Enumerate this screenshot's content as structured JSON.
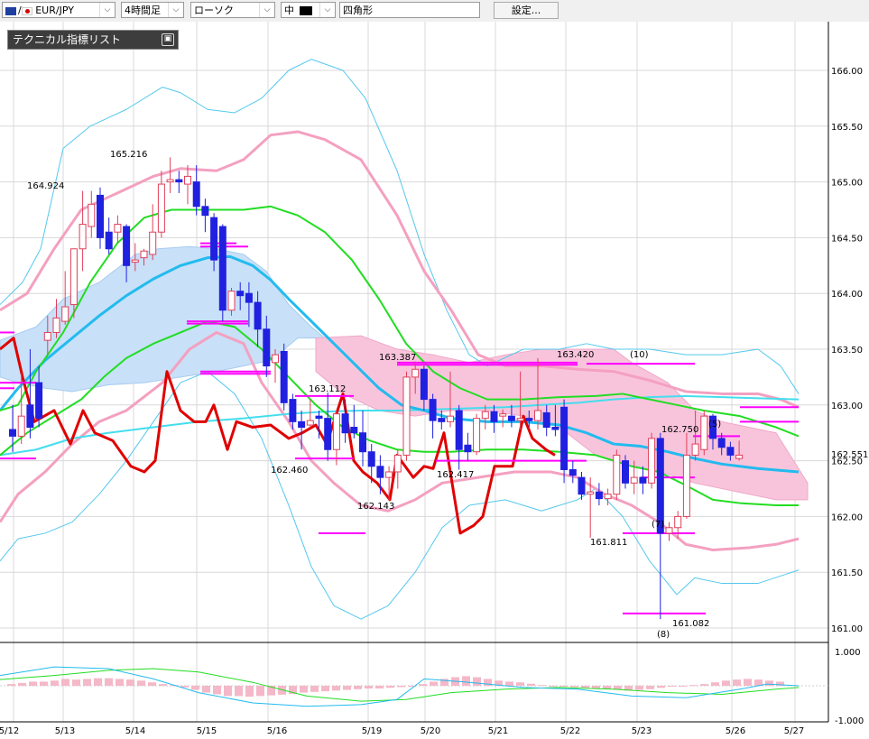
{
  "toolbar": {
    "pair": "EUR/JPY",
    "timeframe": "4時間足",
    "chart_style": "ローソク",
    "size": "中",
    "shape": "四角形",
    "settings_label": "設定..."
  },
  "panel": {
    "title": "テクニカル指標リスト",
    "button_icon": "minimize-icon"
  },
  "colors": {
    "bull_candle": "#e0405a",
    "bear_candle": "#2020e0",
    "bollinger_outer": "#55c8ee",
    "bollinger_inner": "#f4a0c0",
    "ma_green": "#22dd22",
    "ma_blue": "#22bbee",
    "ma_cyan": "#44ddee",
    "red_line": "#e00000",
    "cloud_blue": "#c8e0f8",
    "cloud_pink": "#f8c4dc",
    "pivot": "#ff00ff",
    "label_purple": "#a020a0"
  },
  "chart_data": {
    "type": "candlestick",
    "price_axis": {
      "ylim": [
        160.78,
        166.2
      ],
      "ticks": [
        "166.00",
        "165.50",
        "165.00",
        "164.50",
        "164.00",
        "163.50",
        "163.00",
        "162.50",
        "162.00",
        "161.50",
        "161.00"
      ],
      "current_price": "162.551"
    },
    "sub_axis": {
      "ylim": [
        -1.0,
        1.0
      ],
      "ticks": [
        "1.000",
        "-1.000"
      ]
    },
    "x_labels": [
      "5/12",
      "5/13",
      "5/14",
      "5/15",
      "5/16",
      "5/19",
      "5/20",
      "5/21",
      "5/22",
      "5/23",
      "5/26",
      "5/27"
    ],
    "price_labels": [
      "164.924",
      "165.216",
      "163.112",
      "162.460",
      "162.143",
      "163.387",
      "162.417",
      "163.420",
      "161.811",
      "162.750",
      "161.082"
    ],
    "count_labels": [
      "(10)",
      "(5)",
      "(7)",
      "(8)"
    ],
    "candles": [
      {
        "o": 162.78,
        "h": 163.0,
        "c": 162.72,
        "l": 162.58
      },
      {
        "o": 162.72,
        "h": 163.28,
        "c": 162.9,
        "l": 162.65
      },
      {
        "o": 163.0,
        "h": 163.5,
        "c": 162.8,
        "l": 162.7
      },
      {
        "o": 163.2,
        "h": 163.35,
        "c": 162.88,
        "l": 162.8
      },
      {
        "o": 163.58,
        "h": 163.8,
        "c": 163.65,
        "l": 163.45
      },
      {
        "o": 163.65,
        "h": 163.95,
        "c": 163.78,
        "l": 163.6
      },
      {
        "o": 163.75,
        "h": 164.2,
        "c": 163.88,
        "l": 163.72
      },
      {
        "o": 163.9,
        "h": 164.25,
        "c": 164.4,
        "l": 163.78
      },
      {
        "o": 164.4,
        "h": 164.92,
        "c": 164.62,
        "l": 164.2
      },
      {
        "o": 164.6,
        "h": 164.92,
        "c": 164.8,
        "l": 164.5
      },
      {
        "o": 164.88,
        "h": 164.95,
        "c": 164.5,
        "l": 164.4
      },
      {
        "o": 164.55,
        "h": 164.68,
        "c": 164.4,
        "l": 164.35
      },
      {
        "o": 164.55,
        "h": 164.7,
        "c": 164.62,
        "l": 164.45
      },
      {
        "o": 164.6,
        "h": 164.62,
        "c": 164.25,
        "l": 164.1
      },
      {
        "o": 164.28,
        "h": 164.45,
        "c": 164.3,
        "l": 164.2
      },
      {
        "o": 164.32,
        "h": 164.4,
        "c": 164.38,
        "l": 164.25
      },
      {
        "o": 164.35,
        "h": 164.8,
        "c": 164.55,
        "l": 164.3
      },
      {
        "o": 164.55,
        "h": 165.1,
        "c": 164.98,
        "l": 164.5
      },
      {
        "o": 165.0,
        "h": 165.22,
        "c": 165.02,
        "l": 164.9
      },
      {
        "o": 165.02,
        "h": 165.1,
        "c": 165.0,
        "l": 164.9
      },
      {
        "o": 164.98,
        "h": 165.15,
        "c": 165.05,
        "l": 164.8
      },
      {
        "o": 165.0,
        "h": 165.15,
        "c": 164.78,
        "l": 164.7
      },
      {
        "o": 164.78,
        "h": 164.85,
        "c": 164.7,
        "l": 164.55
      },
      {
        "o": 164.68,
        "h": 164.72,
        "c": 164.3,
        "l": 164.2
      },
      {
        "o": 164.6,
        "h": 164.62,
        "c": 163.85,
        "l": 163.75
      },
      {
        "o": 163.85,
        "h": 164.05,
        "c": 164.02,
        "l": 163.8
      },
      {
        "o": 164.02,
        "h": 164.1,
        "c": 163.98,
        "l": 163.85
      },
      {
        "o": 164.0,
        "h": 164.1,
        "c": 163.92,
        "l": 163.7
      },
      {
        "o": 163.92,
        "h": 164.02,
        "c": 163.68,
        "l": 163.52
      },
      {
        "o": 163.68,
        "h": 163.8,
        "c": 163.35,
        "l": 163.25
      },
      {
        "o": 163.38,
        "h": 163.5,
        "c": 163.45,
        "l": 163.2
      },
      {
        "o": 163.48,
        "h": 163.55,
        "c": 163.02,
        "l": 162.95
      },
      {
        "o": 163.05,
        "h": 163.1,
        "c": 162.85,
        "l": 162.78
      },
      {
        "o": 162.85,
        "h": 162.95,
        "c": 162.8,
        "l": 162.6
      },
      {
        "o": 162.82,
        "h": 163.05,
        "c": 162.86,
        "l": 162.8
      },
      {
        "o": 162.9,
        "h": 162.95,
        "c": 162.88,
        "l": 162.7
      },
      {
        "o": 162.88,
        "h": 163.11,
        "c": 162.6,
        "l": 162.5
      },
      {
        "o": 162.6,
        "h": 162.95,
        "c": 162.92,
        "l": 162.46
      },
      {
        "o": 162.92,
        "h": 163.05,
        "c": 162.75,
        "l": 162.66
      },
      {
        "o": 162.8,
        "h": 163.0,
        "c": 162.75,
        "l": 162.7
      },
      {
        "o": 162.75,
        "h": 162.95,
        "c": 162.58,
        "l": 162.45
      },
      {
        "o": 162.58,
        "h": 162.65,
        "c": 162.45,
        "l": 162.3
      },
      {
        "o": 162.45,
        "h": 162.55,
        "c": 162.35,
        "l": 162.2
      },
      {
        "o": 162.35,
        "h": 162.45,
        "c": 162.4,
        "l": 162.14
      },
      {
        "o": 162.4,
        "h": 162.6,
        "c": 162.55,
        "l": 162.25
      },
      {
        "o": 162.55,
        "h": 163.3,
        "c": 163.25,
        "l": 162.5
      },
      {
        "o": 163.25,
        "h": 163.39,
        "c": 163.32,
        "l": 163.1
      },
      {
        "o": 163.32,
        "h": 163.35,
        "c": 163.05,
        "l": 162.95
      },
      {
        "o": 163.05,
        "h": 163.1,
        "c": 162.86,
        "l": 162.7
      },
      {
        "o": 162.88,
        "h": 162.95,
        "c": 162.85,
        "l": 162.78
      },
      {
        "o": 162.85,
        "h": 163.3,
        "c": 162.9,
        "l": 162.8
      },
      {
        "o": 162.95,
        "h": 163.0,
        "c": 162.6,
        "l": 162.42
      },
      {
        "o": 162.64,
        "h": 162.75,
        "c": 162.58,
        "l": 162.5
      },
      {
        "o": 162.58,
        "h": 162.92,
        "c": 162.88,
        "l": 162.55
      },
      {
        "o": 162.88,
        "h": 163.0,
        "c": 162.94,
        "l": 162.78
      },
      {
        "o": 162.94,
        "h": 163.0,
        "c": 162.85,
        "l": 162.75
      },
      {
        "o": 162.9,
        "h": 162.96,
        "c": 162.92,
        "l": 162.8
      },
      {
        "o": 162.9,
        "h": 163.0,
        "c": 162.86,
        "l": 162.8
      },
      {
        "o": 162.86,
        "h": 163.3,
        "c": 162.88,
        "l": 162.78
      },
      {
        "o": 162.88,
        "h": 162.95,
        "c": 162.86,
        "l": 162.8
      },
      {
        "o": 162.86,
        "h": 163.42,
        "c": 162.95,
        "l": 162.78
      },
      {
        "o": 162.93,
        "h": 163.0,
        "c": 162.8,
        "l": 162.72
      },
      {
        "o": 162.8,
        "h": 163.0,
        "c": 162.78,
        "l": 162.72
      },
      {
        "o": 162.98,
        "h": 163.05,
        "c": 162.42,
        "l": 162.3
      },
      {
        "o": 162.42,
        "h": 162.5,
        "c": 162.37,
        "l": 162.3
      },
      {
        "o": 162.35,
        "h": 162.4,
        "c": 162.2,
        "l": 162.15
      },
      {
        "o": 162.2,
        "h": 162.35,
        "c": 162.22,
        "l": 161.81
      },
      {
        "o": 162.22,
        "h": 162.3,
        "c": 162.16,
        "l": 162.1
      },
      {
        "o": 162.16,
        "h": 162.25,
        "c": 162.2,
        "l": 162.1
      },
      {
        "o": 162.2,
        "h": 162.6,
        "c": 162.55,
        "l": 162.15
      },
      {
        "o": 162.5,
        "h": 162.55,
        "c": 162.3,
        "l": 162.25
      },
      {
        "o": 162.3,
        "h": 162.5,
        "c": 162.35,
        "l": 162.2
      },
      {
        "o": 162.35,
        "h": 162.45,
        "c": 162.3,
        "l": 162.2
      },
      {
        "o": 162.3,
        "h": 162.75,
        "c": 162.7,
        "l": 162.25
      },
      {
        "o": 162.7,
        "h": 162.75,
        "c": 161.85,
        "l": 161.08
      },
      {
        "o": 161.85,
        "h": 161.95,
        "c": 161.9,
        "l": 161.78
      },
      {
        "o": 161.9,
        "h": 162.05,
        "c": 162.0,
        "l": 161.8
      },
      {
        "o": 162.0,
        "h": 162.75,
        "c": 162.55,
        "l": 161.98
      },
      {
        "o": 162.55,
        "h": 162.95,
        "c": 162.65,
        "l": 162.5
      },
      {
        "o": 162.6,
        "h": 162.95,
        "c": 162.9,
        "l": 162.55
      },
      {
        "o": 162.9,
        "h": 162.92,
        "c": 162.7,
        "l": 162.6
      },
      {
        "o": 162.7,
        "h": 162.75,
        "c": 162.62,
        "l": 162.55
      },
      {
        "o": 162.62,
        "h": 162.67,
        "c": 162.55,
        "l": 162.5
      },
      {
        "o": 162.52,
        "h": 162.68,
        "c": 162.55,
        "l": 162.5
      }
    ]
  }
}
